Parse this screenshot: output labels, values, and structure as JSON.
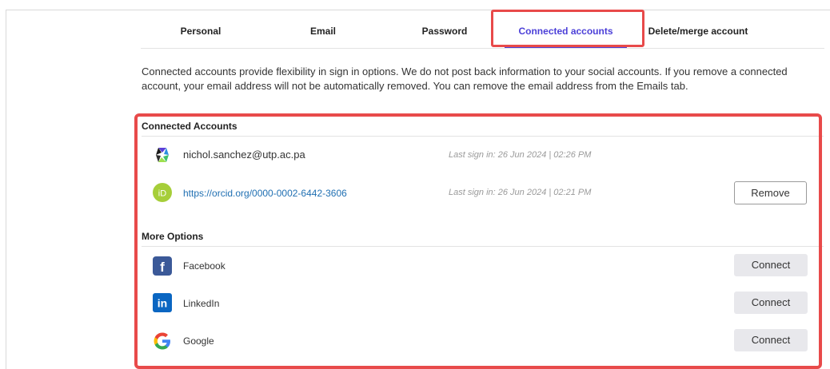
{
  "tabs": [
    {
      "label": "Personal"
    },
    {
      "label": "Email"
    },
    {
      "label": "Password"
    },
    {
      "label": "Connected accounts"
    },
    {
      "label": "Delete/merge account"
    }
  ],
  "description": "Connected accounts provide flexibility in sign in options. We do not post back information to your social accounts. If you remove a connected account, your email address will not be automatically removed. You can remove the email address from the Emails tab.",
  "connected": {
    "title": "Connected Accounts",
    "items": [
      {
        "name": "nichol.sanchez@utp.ac.pa",
        "icon": "clarivate-icon",
        "last_sign": "Last sign in: 26 Jun 2024 | 02:26 PM"
      },
      {
        "name": "https://orcid.org/0000-0002-6442-3606",
        "icon": "orcid-icon",
        "last_sign": "Last sign in: 26 Jun 2024 | 02:21 PM",
        "action": "Remove"
      }
    ]
  },
  "more": {
    "title": "More Options",
    "items": [
      {
        "name": "Facebook",
        "icon": "facebook-icon",
        "action": "Connect"
      },
      {
        "name": "LinkedIn",
        "icon": "linkedin-icon",
        "action": "Connect"
      },
      {
        "name": "Google",
        "icon": "google-icon",
        "action": "Connect"
      }
    ]
  },
  "colors": {
    "accent": "#4b3fd8",
    "highlight": "#e84a4a",
    "link": "#1f6fb2"
  }
}
